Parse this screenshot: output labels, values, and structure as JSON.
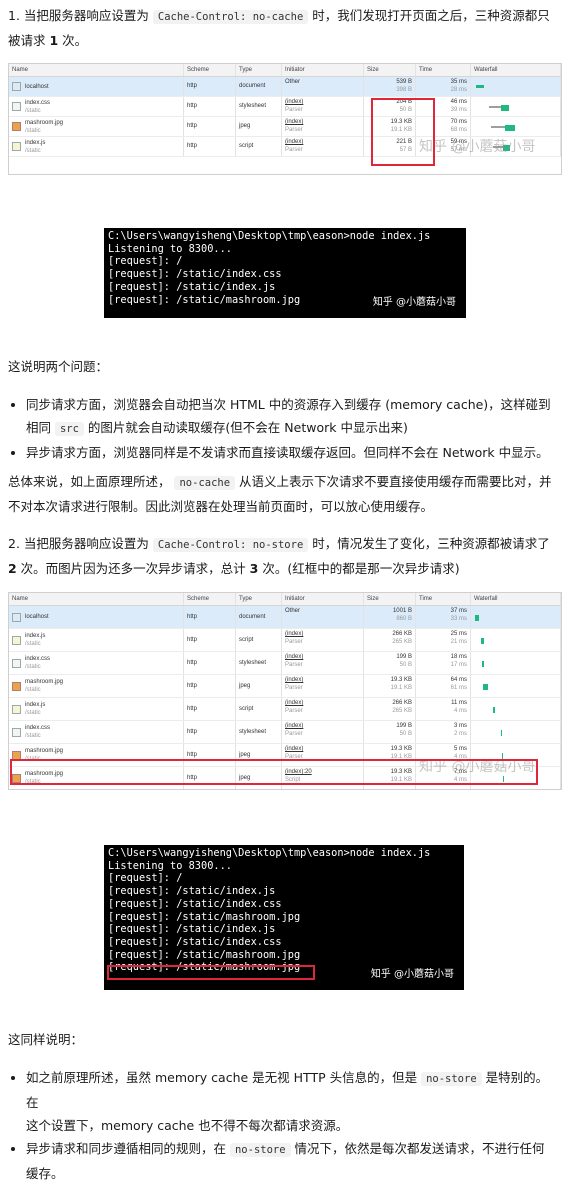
{
  "section1": {
    "line_a_pre": "1. 当把服务器响应设置为 ",
    "code": "Cache-Control: no-cache",
    "line_a_post": " 时，我们发现打开页面之后，三种资源都只",
    "line_b_pre": "被请求 ",
    "count": "1",
    "line_b_post": " 次。"
  },
  "net1": {
    "headers": [
      "Name",
      "Scheme",
      "Type",
      "Initiator",
      "Size",
      "Time",
      "Waterfall"
    ],
    "rows": [
      {
        "name": "localhost",
        "path": "",
        "scheme": "http",
        "type": "document",
        "init1": "Other",
        "init2": "",
        "size1": "539 B",
        "size2": "398 B",
        "time1": "35 ms",
        "time2": "28 ms",
        "icon": "doc"
      },
      {
        "name": "index.css",
        "path": "/static",
        "scheme": "http",
        "type": "stylesheet",
        "init1": "(index)",
        "init2": "Parser",
        "size1": "204 B",
        "size2": "50 B",
        "time1": "46 ms",
        "time2": "39 ms",
        "icon": "css"
      },
      {
        "name": "mashroom.jpg",
        "path": "/static",
        "scheme": "http",
        "type": "jpeg",
        "init1": "(index)",
        "init2": "Parser",
        "size1": "19.3 KB",
        "size2": "19.1 KB",
        "time1": "70 ms",
        "time2": "68 ms",
        "icon": "img"
      },
      {
        "name": "index.js",
        "path": "/static",
        "scheme": "http",
        "type": "script",
        "init1": "(index)",
        "init2": "Parser",
        "size1": "221 B",
        "size2": "57 B",
        "time1": "59 ms",
        "time2": "57 ms",
        "icon": "js"
      }
    ],
    "watermark": "知乎 @小蘑菇小哥"
  },
  "term1": {
    "lines": [
      "C:\\Users\\wangyisheng\\Desktop\\tmp\\eason>node index.js",
      "Listening to 8300...",
      "[request]: /",
      "[request]: /static/index.css",
      "[request]: /static/index.js",
      "[request]: /static/mashroom.jpg"
    ],
    "watermark": "知乎 @小蘑菇小哥"
  },
  "explain1": {
    "intro": "这说明两个问题：",
    "b1_a": "同步请求方面，浏览器会自动把当次 HTML 中的资源存入到缓存 (memory cache)，这样碰到",
    "b1_b_pre": "相同 ",
    "b1_code": "src",
    "b1_b_post": " 的图片就会自动读取缓存(但不会在 Network 中显示出来)",
    "b2": "异步请求方面，浏览器同样是不发请求而直接读取缓存返回。但同样不会在 Network 中显示。",
    "sum_a_pre": "总体来说，如上面原理所述， ",
    "sum_code": "no-cache",
    "sum_a_post": " 从语义上表示下次请求不要直接使用缓存而需要比对，并",
    "sum_b": "不对本次请求进行限制。因此浏览器在处理当前页面时，可以放心使用缓存。"
  },
  "section2": {
    "line_a_pre": "2. 当把服务器响应设置为 ",
    "code": "Cache-Control: no-store",
    "line_a_post": " 时，情况发生了变化，三种资源都被请求了",
    "count1": "2",
    "line_b_mid": " 次。而图片因为还多一次异步请求，总计 ",
    "count2": "3",
    "line_b_post": " 次。(红框中的都是那一次异步请求)"
  },
  "net2": {
    "headers": [
      "Name",
      "Scheme",
      "Type",
      "Initiator",
      "Size",
      "Time",
      "Waterfall"
    ],
    "rows": [
      {
        "name": "localhost",
        "path": "",
        "scheme": "http",
        "type": "document",
        "init1": "Other",
        "init2": "",
        "size1": "1001 B",
        "size2": "860 B",
        "time1": "37 ms",
        "time2": "33 ms",
        "icon": "doc"
      },
      {
        "name": "index.js",
        "path": "/static",
        "scheme": "http",
        "type": "script",
        "init1": "(index)",
        "init2": "Parser",
        "size1": "266 KB",
        "size2": "265 KB",
        "time1": "25 ms",
        "time2": "21 ms",
        "icon": "js"
      },
      {
        "name": "index.css",
        "path": "/static",
        "scheme": "http",
        "type": "stylesheet",
        "init1": "(index)",
        "init2": "Parser",
        "size1": "199 B",
        "size2": "50 B",
        "time1": "18 ms",
        "time2": "17 ms",
        "icon": "css"
      },
      {
        "name": "mashroom.jpg",
        "path": "/static",
        "scheme": "http",
        "type": "jpeg",
        "init1": "(index)",
        "init2": "Parser",
        "size1": "19.3 KB",
        "size2": "19.1 KB",
        "time1": "64 ms",
        "time2": "61 ms",
        "icon": "img"
      },
      {
        "name": "index.js",
        "path": "/static",
        "scheme": "http",
        "type": "script",
        "init1": "(index)",
        "init2": "Parser",
        "size1": "266 KB",
        "size2": "265 KB",
        "time1": "11 ms",
        "time2": "4 ms",
        "icon": "js"
      },
      {
        "name": "index.css",
        "path": "/static",
        "scheme": "http",
        "type": "stylesheet",
        "init1": "(index)",
        "init2": "Parser",
        "size1": "199 B",
        "size2": "50 B",
        "time1": "3 ms",
        "time2": "2 ms",
        "icon": "css"
      },
      {
        "name": "mashroom.jpg",
        "path": "/static",
        "scheme": "http",
        "type": "jpeg",
        "init1": "(index)",
        "init2": "Parser",
        "size1": "19.3 KB",
        "size2": "19.1 KB",
        "time1": "5 ms",
        "time2": "4 ms",
        "icon": "img"
      },
      {
        "name": "mashroom.jpg",
        "path": "/static",
        "scheme": "http",
        "type": "jpeg",
        "init1": "(index):20",
        "init2": "Script",
        "size1": "19.3 KB",
        "size2": "19.1 KB",
        "time1": "7 ms",
        "time2": "4 ms",
        "icon": "img"
      }
    ],
    "watermark": "知乎 @小蘑菇小哥"
  },
  "term2": {
    "lines": [
      "C:\\Users\\wangyisheng\\Desktop\\tmp\\eason>node index.js",
      "Listening to 8300...",
      "[request]: /",
      "[request]: /static/index.js",
      "[request]: /static/index.css",
      "[request]: /static/mashroom.jpg",
      "[request]: /static/index.js",
      "[request]: /static/index.css",
      "[request]: /static/mashroom.jpg",
      "[request]: /static/mashroom.jpg"
    ],
    "watermark": "知乎 @小蘑菇小哥"
  },
  "explain2": {
    "intro": "这同样说明：",
    "b1_a_pre": "如之前原理所述，虽然 memory cache 是无视 HTTP 头信息的，但是 ",
    "b1_code": "no-store",
    "b1_a_post": " 是特别的。在",
    "b1_b": "这个设置下，memory cache 也不得不每次都请求资源。",
    "b2_a_pre": "异步请求和同步遵循相同的规则，在 ",
    "b2_code": "no-store",
    "b2_a_post": " 情况下，依然是每次都发送请求，不进行任何",
    "b2_b": "缓存。"
  },
  "colors": {
    "highlight_red": "#e0263a",
    "waterfall_green": "#1eb980",
    "waterfall_grey": "#9e9e9e"
  }
}
